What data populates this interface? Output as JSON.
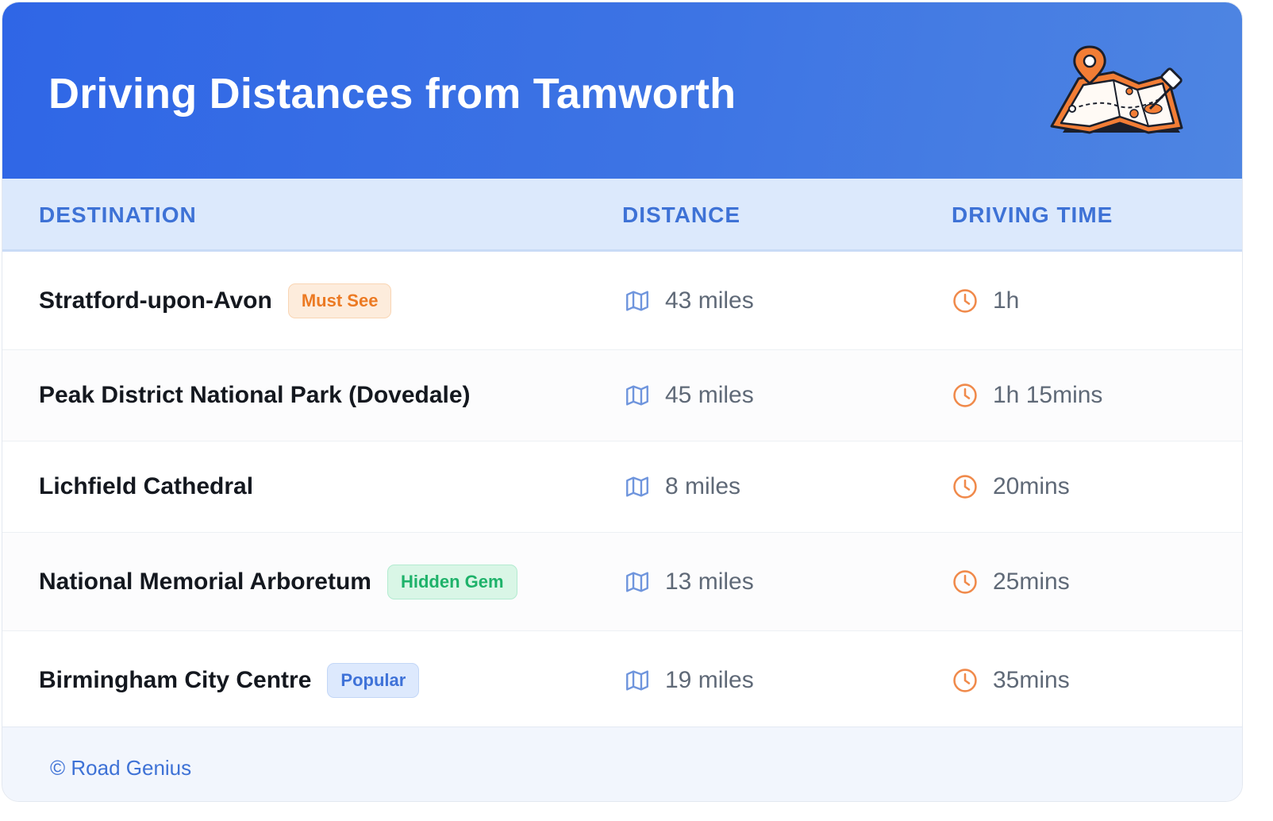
{
  "header": {
    "title": "Driving Distances from Tamworth",
    "illustration_icon": "map-pin-illustration-icon"
  },
  "columns": {
    "destination": "DESTINATION",
    "distance": "DISTANCE",
    "driving_time": "DRIVING TIME"
  },
  "rows": [
    {
      "destination": "Stratford-upon-Avon",
      "badge": "Must See",
      "badge_color": "orange",
      "distance": "43 miles",
      "time": "1h"
    },
    {
      "destination": "Peak District National Park (Dovedale)",
      "badge": "",
      "badge_color": "",
      "distance": "45 miles",
      "time": "1h 15mins"
    },
    {
      "destination": "Lichfield Cathedral",
      "badge": "",
      "badge_color": "",
      "distance": "8 miles",
      "time": "20mins"
    },
    {
      "destination": "National Memorial Arboretum",
      "badge": "Hidden Gem",
      "badge_color": "green",
      "distance": "13 miles",
      "time": "25mins"
    },
    {
      "destination": "Birmingham City Centre",
      "badge": "Popular",
      "badge_color": "blue",
      "distance": "19 miles",
      "time": "35mins"
    }
  ],
  "icons": {
    "distance": "map-icon",
    "time": "clock-icon"
  },
  "footer": {
    "text": "© Road Genius"
  },
  "colors": {
    "header_start": "#2f66e6",
    "header_end": "#4e85e2",
    "accent_blue": "#3e72d6",
    "map_icon": "#6f95dd",
    "clock_icon": "#f08a4b"
  }
}
